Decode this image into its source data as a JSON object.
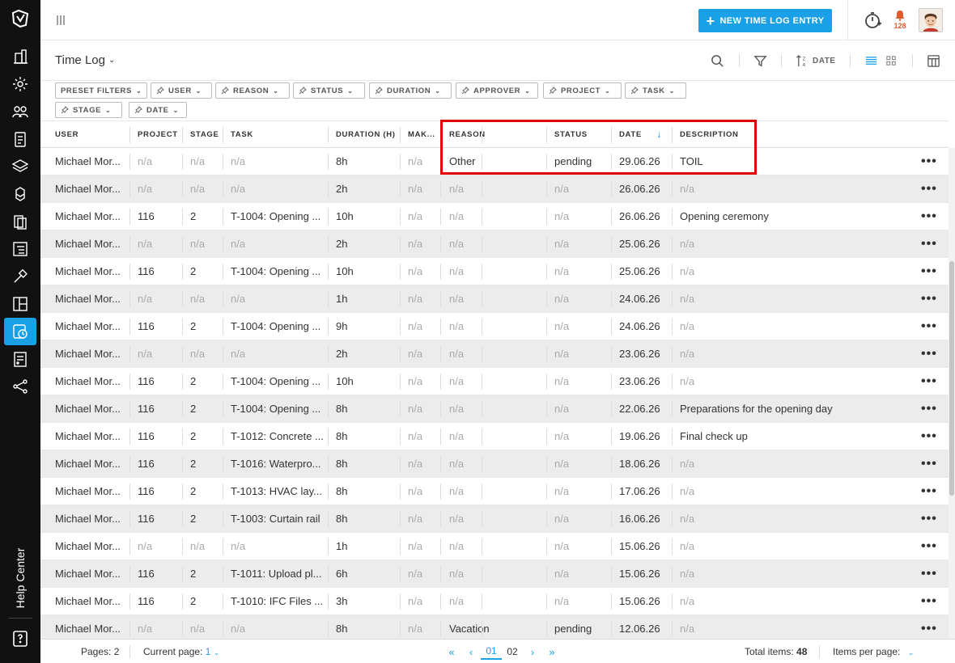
{
  "topbar": {
    "new_entry_label": "NEW TIME LOG ENTRY",
    "notification_count": "128",
    "accent_color": "#1aa0e6"
  },
  "titlebar": {
    "title": "Time Log",
    "sort_label": "DATE"
  },
  "sidebar": {
    "items": [
      "building-icon",
      "settings-cube-icon",
      "users-icon",
      "clipboard-icon",
      "layers-icon",
      "cubes-icon",
      "documents-icon",
      "tree-list-icon",
      "hammer-icon",
      "layout-icon",
      "timelog-icon",
      "report-icon",
      "share-icon"
    ],
    "help_label": "Help Center"
  },
  "filters": [
    "PRESET FILTERS",
    "USER",
    "REASON",
    "STATUS",
    "DURATION",
    "APPROVER",
    "PROJECT",
    "TASK",
    "STAGE",
    "DATE"
  ],
  "columns": [
    "USER",
    "PROJECT",
    "STAGE",
    "TASK",
    "DURATION (H)",
    "MAK...",
    "REASON",
    "STATUS",
    "DATE",
    "DESCRIPTION"
  ],
  "rows": [
    [
      "Michael Mor...",
      "n/a",
      "n/a",
      "n/a",
      "8h",
      "n/a",
      "Other",
      "pending",
      "29.06.26",
      "TOIL"
    ],
    [
      "Michael Mor...",
      "n/a",
      "n/a",
      "n/a",
      "2h",
      "n/a",
      "n/a",
      "n/a",
      "26.06.26",
      "n/a"
    ],
    [
      "Michael Mor...",
      "116",
      "2",
      "T-1004: Opening ...",
      "10h",
      "n/a",
      "n/a",
      "n/a",
      "26.06.26",
      "Opening ceremony"
    ],
    [
      "Michael Mor...",
      "n/a",
      "n/a",
      "n/a",
      "2h",
      "n/a",
      "n/a",
      "n/a",
      "25.06.26",
      "n/a"
    ],
    [
      "Michael Mor...",
      "116",
      "2",
      "T-1004: Opening ...",
      "10h",
      "n/a",
      "n/a",
      "n/a",
      "25.06.26",
      "n/a"
    ],
    [
      "Michael Mor...",
      "n/a",
      "n/a",
      "n/a",
      "1h",
      "n/a",
      "n/a",
      "n/a",
      "24.06.26",
      "n/a"
    ],
    [
      "Michael Mor...",
      "116",
      "2",
      "T-1004: Opening ...",
      "9h",
      "n/a",
      "n/a",
      "n/a",
      "24.06.26",
      "n/a"
    ],
    [
      "Michael Mor...",
      "n/a",
      "n/a",
      "n/a",
      "2h",
      "n/a",
      "n/a",
      "n/a",
      "23.06.26",
      "n/a"
    ],
    [
      "Michael Mor...",
      "116",
      "2",
      "T-1004: Opening ...",
      "10h",
      "n/a",
      "n/a",
      "n/a",
      "23.06.26",
      "n/a"
    ],
    [
      "Michael Mor...",
      "116",
      "2",
      "T-1004: Opening ...",
      "8h",
      "n/a",
      "n/a",
      "n/a",
      "22.06.26",
      "Preparations for the opening day"
    ],
    [
      "Michael Mor...",
      "116",
      "2",
      "T-1012: Concrete ...",
      "8h",
      "n/a",
      "n/a",
      "n/a",
      "19.06.26",
      "Final check up"
    ],
    [
      "Michael Mor...",
      "116",
      "2",
      "T-1016: Waterpro...",
      "8h",
      "n/a",
      "n/a",
      "n/a",
      "18.06.26",
      "n/a"
    ],
    [
      "Michael Mor...",
      "116",
      "2",
      "T-1013: HVAC lay...",
      "8h",
      "n/a",
      "n/a",
      "n/a",
      "17.06.26",
      "n/a"
    ],
    [
      "Michael Mor...",
      "116",
      "2",
      "T-1003: Curtain rail",
      "8h",
      "n/a",
      "n/a",
      "n/a",
      "16.06.26",
      "n/a"
    ],
    [
      "Michael Mor...",
      "n/a",
      "n/a",
      "n/a",
      "1h",
      "n/a",
      "n/a",
      "n/a",
      "15.06.26",
      "n/a"
    ],
    [
      "Michael Mor...",
      "116",
      "2",
      "T-1011: Upload pl...",
      "6h",
      "n/a",
      "n/a",
      "n/a",
      "15.06.26",
      "n/a"
    ],
    [
      "Michael Mor...",
      "116",
      "2",
      "T-1010: IFC Files ...",
      "3h",
      "n/a",
      "n/a",
      "n/a",
      "15.06.26",
      "n/a"
    ],
    [
      "Michael Mor...",
      "n/a",
      "n/a",
      "n/a",
      "8h",
      "n/a",
      "Vacation",
      "pending",
      "12.06.26",
      "n/a"
    ]
  ],
  "footer": {
    "pages_label": "Pages:",
    "pages_value": "2",
    "current_page_label": "Current page:",
    "current_page_value": "1",
    "page_numbers": [
      "01",
      "02"
    ],
    "total_items_label": "Total items:",
    "total_items_value": "48",
    "items_per_page_label": "Items per page:"
  }
}
